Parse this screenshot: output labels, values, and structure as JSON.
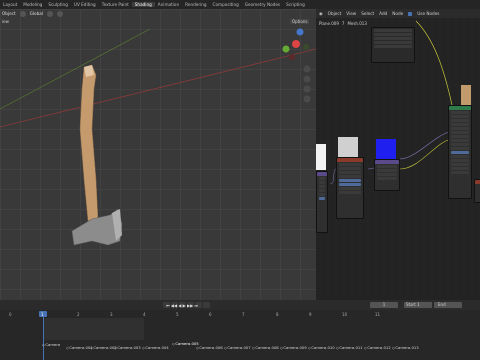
{
  "menu": {
    "tabs": [
      "Layout",
      "Modeling",
      "Sculpting",
      "UV Editing",
      "Texture Paint",
      "Shading",
      "Animation",
      "Rendering",
      "Compositing",
      "Geometry Nodes",
      "Scripting"
    ],
    "active": "Shading",
    "left_label": "Object"
  },
  "viewport": {
    "header": {
      "transform": "Global",
      "options": "Options",
      "view_label": "iew"
    }
  },
  "node_editor": {
    "header": {
      "mode": "Object",
      "view": "View",
      "select": "Select",
      "add": "Add",
      "node": "Node",
      "use_nodes": "Use Nodes"
    },
    "sub": {
      "object": "Plane.009",
      "slot": "7",
      "material": "Mesh.013"
    }
  },
  "timeline": {
    "current_frame": "1",
    "start_label": "Start",
    "start_value": "1",
    "end_label": "End",
    "frame_numbers": [
      "0",
      "1",
      "2",
      "3",
      "4",
      "5",
      "6",
      "7",
      "8",
      "9",
      "10",
      "11"
    ],
    "markers": [
      "Camera",
      "Camera.001",
      "Camera.002",
      "Camera.003",
      "Camera.004",
      "Camera.005",
      "Camera.006",
      "Camera.007",
      "Camera.008",
      "Camera.009",
      "Camera.010",
      "Camera.011",
      "Camera.012",
      "Camera.013"
    ]
  },
  "colors": {
    "accent_blue": "#4772b3",
    "handle": "#c39a6b",
    "axe_head": "#8a8a8a",
    "blue_preview": "#1f1ff0",
    "node_header_green": "#2f7a4b",
    "node_header_red": "#8a3a2a",
    "node_header_purple": "#5a4a8a"
  }
}
